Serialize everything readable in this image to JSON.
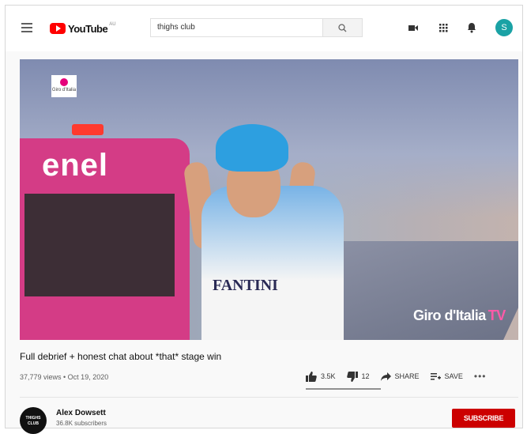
{
  "header": {
    "logo_text": "YouTube",
    "logo_sup": "AU",
    "search_value": "thighs club",
    "avatar_letter": "S",
    "icons": [
      "menu-icon",
      "youtube-logo",
      "search-icon",
      "create-video-icon",
      "apps-grid-icon",
      "notifications-bell-icon"
    ]
  },
  "video": {
    "car_text": "enel",
    "jersey_text": "FANTINI",
    "badge_text": "Giro d'Italia",
    "watermark": "Giro d'Italia",
    "watermark_suffix": "TV"
  },
  "info": {
    "title": "Full debrief + honest chat about *that* stage win",
    "meta": "37,779 views • Oct 19, 2020",
    "likes": "3.5K",
    "dislikes": "12",
    "share_label": "SHARE",
    "save_label": "SAVE",
    "like_ratio": 0.997
  },
  "channel": {
    "avatar_text": "THIGHS CLUB",
    "name": "Alex Dowsett",
    "subscribers": "36.8K subscribers",
    "subscribe_label": "SUBSCRIBE"
  },
  "colors": {
    "brand_red": "#ff0000",
    "subscribe_red": "#cc0000",
    "avatar_teal": "#1aa2a5"
  }
}
